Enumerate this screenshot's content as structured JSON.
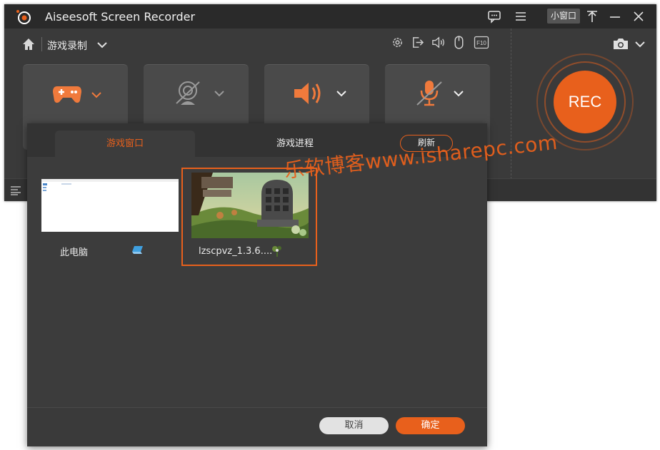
{
  "app": {
    "title": "Aiseesoft Screen Recorder",
    "mini_window_label": "小窗口",
    "mode_label": "游戏录制",
    "rec_label": "REC"
  },
  "dialog": {
    "tabs": [
      {
        "label": "游戏窗口",
        "active": true
      },
      {
        "label": "游戏进程",
        "active": false
      }
    ],
    "refresh_label": "刷新",
    "windows": [
      {
        "label": "此电脑",
        "icon": "computer-icon",
        "selected": false
      },
      {
        "label": "lzscpvz_1.3.6....",
        "icon": "plant-icon",
        "selected": true
      }
    ],
    "cancel_label": "取消",
    "ok_label": "确定"
  },
  "watermark": "乐软博客www.isharepc.com",
  "colors": {
    "accent": "#e8601c",
    "titlebar": "#2a2a2a",
    "body": "#3a3a3a"
  }
}
